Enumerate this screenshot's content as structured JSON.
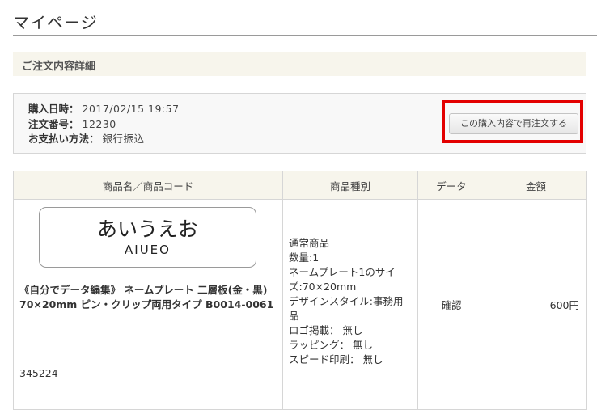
{
  "page": {
    "title": "マイページ"
  },
  "section": {
    "title": "ご注文内容詳細"
  },
  "order": {
    "date_label": "購入日時：",
    "date_value": "2017/02/15 19:57",
    "number_label": "注文番号：",
    "number_value": "12230",
    "payment_label": "お支払い方法：",
    "payment_value": "銀行振込",
    "reorder_label": "この購入内容で再注文する"
  },
  "table": {
    "headers": [
      "商品名／商品コード",
      "商品種別",
      "データ",
      "金額"
    ],
    "rows": [
      {
        "plate_main": "あいうえお",
        "plate_sub": "AIUEO",
        "name": "《自分でデータ編集》 ネームプレート 二層板(金・黒) 70×20mm ピン・クリップ両用タイプ B0014-0061",
        "code": "345224",
        "specs": [
          "通常商品",
          "数量:1",
          "ネームプレート1のサイズ:70×20mm",
          "デザインスタイル:事務用品",
          "ロゴ掲載： 無し",
          "ラッピング： 無し",
          "スピード印刷： 無し"
        ],
        "data_label": "確認",
        "price": "600円"
      }
    ]
  }
}
